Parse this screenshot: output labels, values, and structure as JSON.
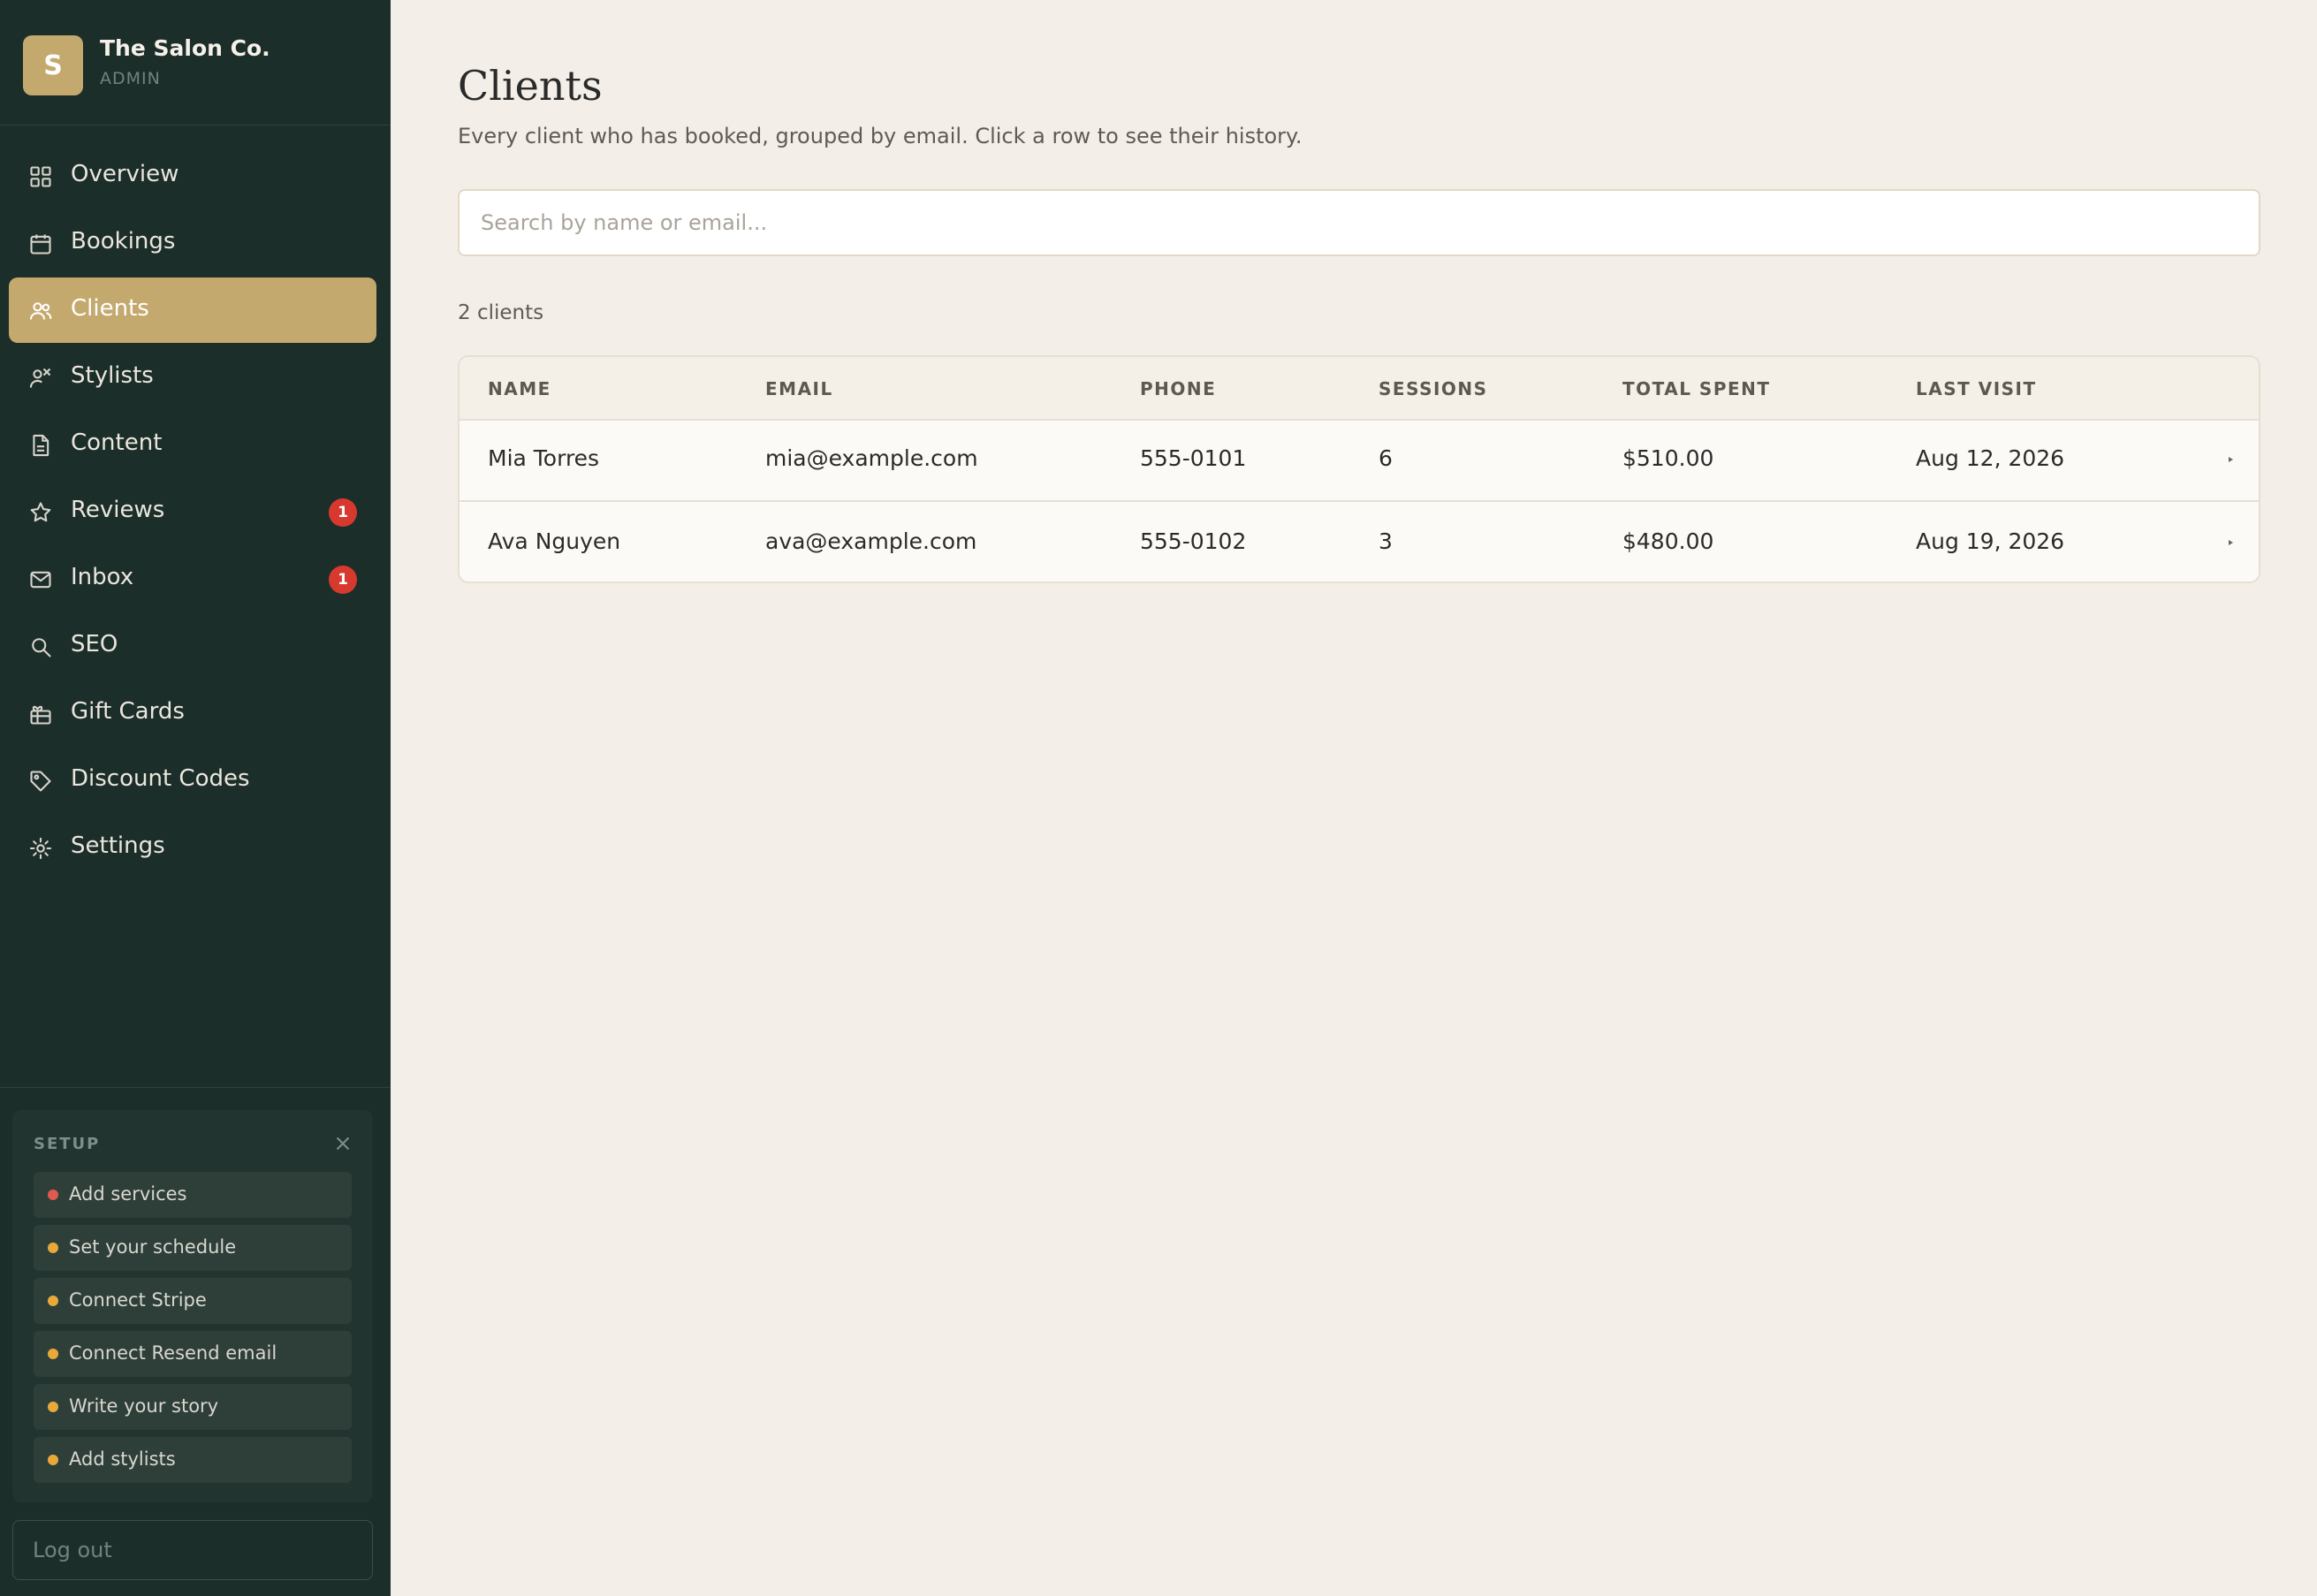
{
  "brand": {
    "logo_letter": "S",
    "name": "The Salon Co.",
    "role": "ADMIN"
  },
  "nav": [
    {
      "label": "Overview",
      "icon": "grid-icon",
      "active": false,
      "badge": ""
    },
    {
      "label": "Bookings",
      "icon": "calendar-icon",
      "active": false,
      "badge": ""
    },
    {
      "label": "Clients",
      "icon": "users-icon",
      "active": true,
      "badge": ""
    },
    {
      "label": "Stylists",
      "icon": "stylist-icon",
      "active": false,
      "badge": ""
    },
    {
      "label": "Content",
      "icon": "document-icon",
      "active": false,
      "badge": ""
    },
    {
      "label": "Reviews",
      "icon": "star-icon",
      "active": false,
      "badge": "1"
    },
    {
      "label": "Inbox",
      "icon": "mail-icon",
      "active": false,
      "badge": "1"
    },
    {
      "label": "SEO",
      "icon": "search-icon",
      "active": false,
      "badge": ""
    },
    {
      "label": "Gift Cards",
      "icon": "gift-icon",
      "active": false,
      "badge": ""
    },
    {
      "label": "Discount Codes",
      "icon": "tag-icon",
      "active": false,
      "badge": ""
    },
    {
      "label": "Settings",
      "icon": "gear-icon",
      "active": false,
      "badge": ""
    }
  ],
  "setup": {
    "title": "SETUP",
    "items": [
      {
        "label": "Add services",
        "status_color": "#e05a4f"
      },
      {
        "label": "Set your schedule",
        "status_color": "#e8a93a"
      },
      {
        "label": "Connect Stripe",
        "status_color": "#e8a93a"
      },
      {
        "label": "Connect Resend email",
        "status_color": "#e8a93a"
      },
      {
        "label": "Write your story",
        "status_color": "#e8a93a"
      },
      {
        "label": "Add stylists",
        "status_color": "#e8a93a"
      }
    ]
  },
  "logout_label": "Log out",
  "main": {
    "title": "Clients",
    "subtitle": "Every client who has booked, grouped by email. Click a row to see their history.",
    "search_placeholder": "Search by name or email...",
    "count_label": "2 clients",
    "table": {
      "columns": [
        "NAME",
        "EMAIL",
        "PHONE",
        "SESSIONS",
        "TOTAL SPENT",
        "LAST VISIT"
      ],
      "rows": [
        {
          "name": "Mia Torres",
          "email": "mia@example.com",
          "phone": "555-0101",
          "sessions": "6",
          "total_spent": "$510.00",
          "last_visit": "Aug 12, 2026"
        },
        {
          "name": "Ava Nguyen",
          "email": "ava@example.com",
          "phone": "555-0102",
          "sessions": "3",
          "total_spent": "$480.00",
          "last_visit": "Aug 19, 2026"
        }
      ]
    }
  },
  "colors": {
    "sidebar_bg": "#1c2e29",
    "accent_gold": "#c4a96e",
    "badge_red": "#d8392f",
    "page_bg": "#f3efe8"
  }
}
